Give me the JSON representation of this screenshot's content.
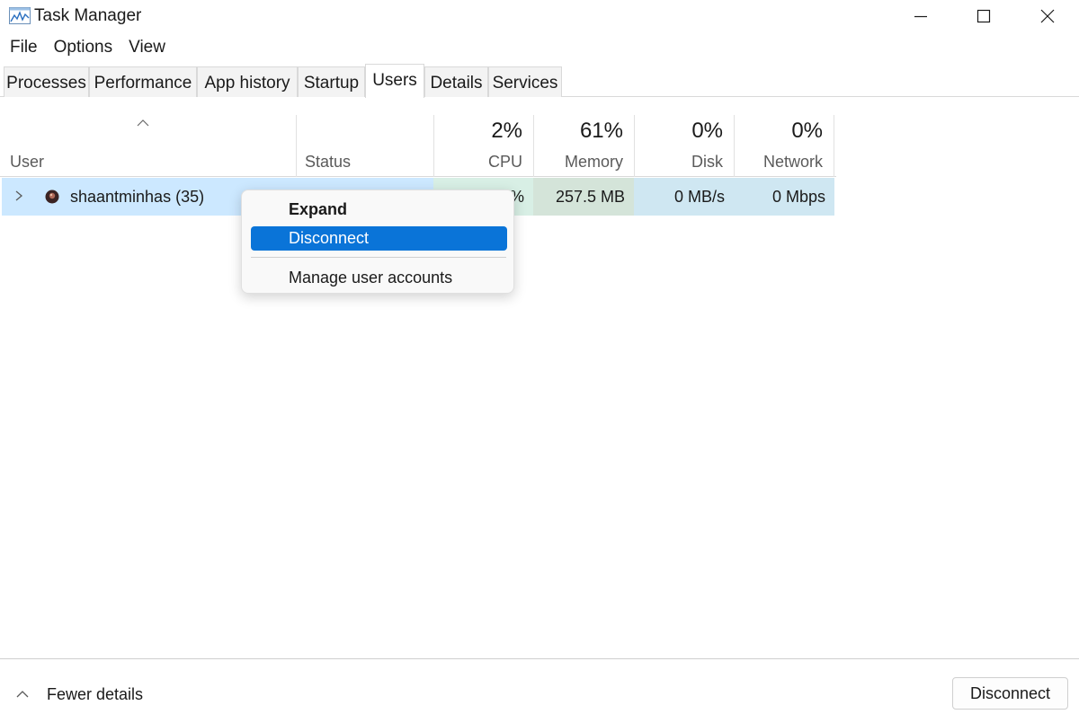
{
  "window": {
    "title": "Task Manager"
  },
  "menu": [
    "File",
    "Options",
    "View"
  ],
  "tabs": [
    {
      "label": "Processes",
      "active": false
    },
    {
      "label": "Performance",
      "active": false
    },
    {
      "label": "App history",
      "active": false
    },
    {
      "label": "Startup",
      "active": false
    },
    {
      "label": "Users",
      "active": true
    },
    {
      "label": "Details",
      "active": false
    },
    {
      "label": "Services",
      "active": false
    }
  ],
  "columns": {
    "user": "User",
    "status": "Status",
    "cpu": {
      "label": "CPU",
      "pct": "2%"
    },
    "memory": {
      "label": "Memory",
      "pct": "61%"
    },
    "disk": {
      "label": "Disk",
      "pct": "0%"
    },
    "network": {
      "label": "Network",
      "pct": "0%"
    }
  },
  "row": {
    "user": "shaantminhas (35)",
    "status": "",
    "cpu": "%",
    "memory": "257.5 MB",
    "disk": "0 MB/s",
    "network": "0 Mbps"
  },
  "context_menu": {
    "expand": "Expand",
    "disconnect": "Disconnect",
    "manage": "Manage user accounts"
  },
  "footer": {
    "fewer_details": "Fewer details",
    "disconnect_button": "Disconnect"
  },
  "colors": {
    "selection": "#cce8ff",
    "menu_highlight": "#0a74d8"
  }
}
